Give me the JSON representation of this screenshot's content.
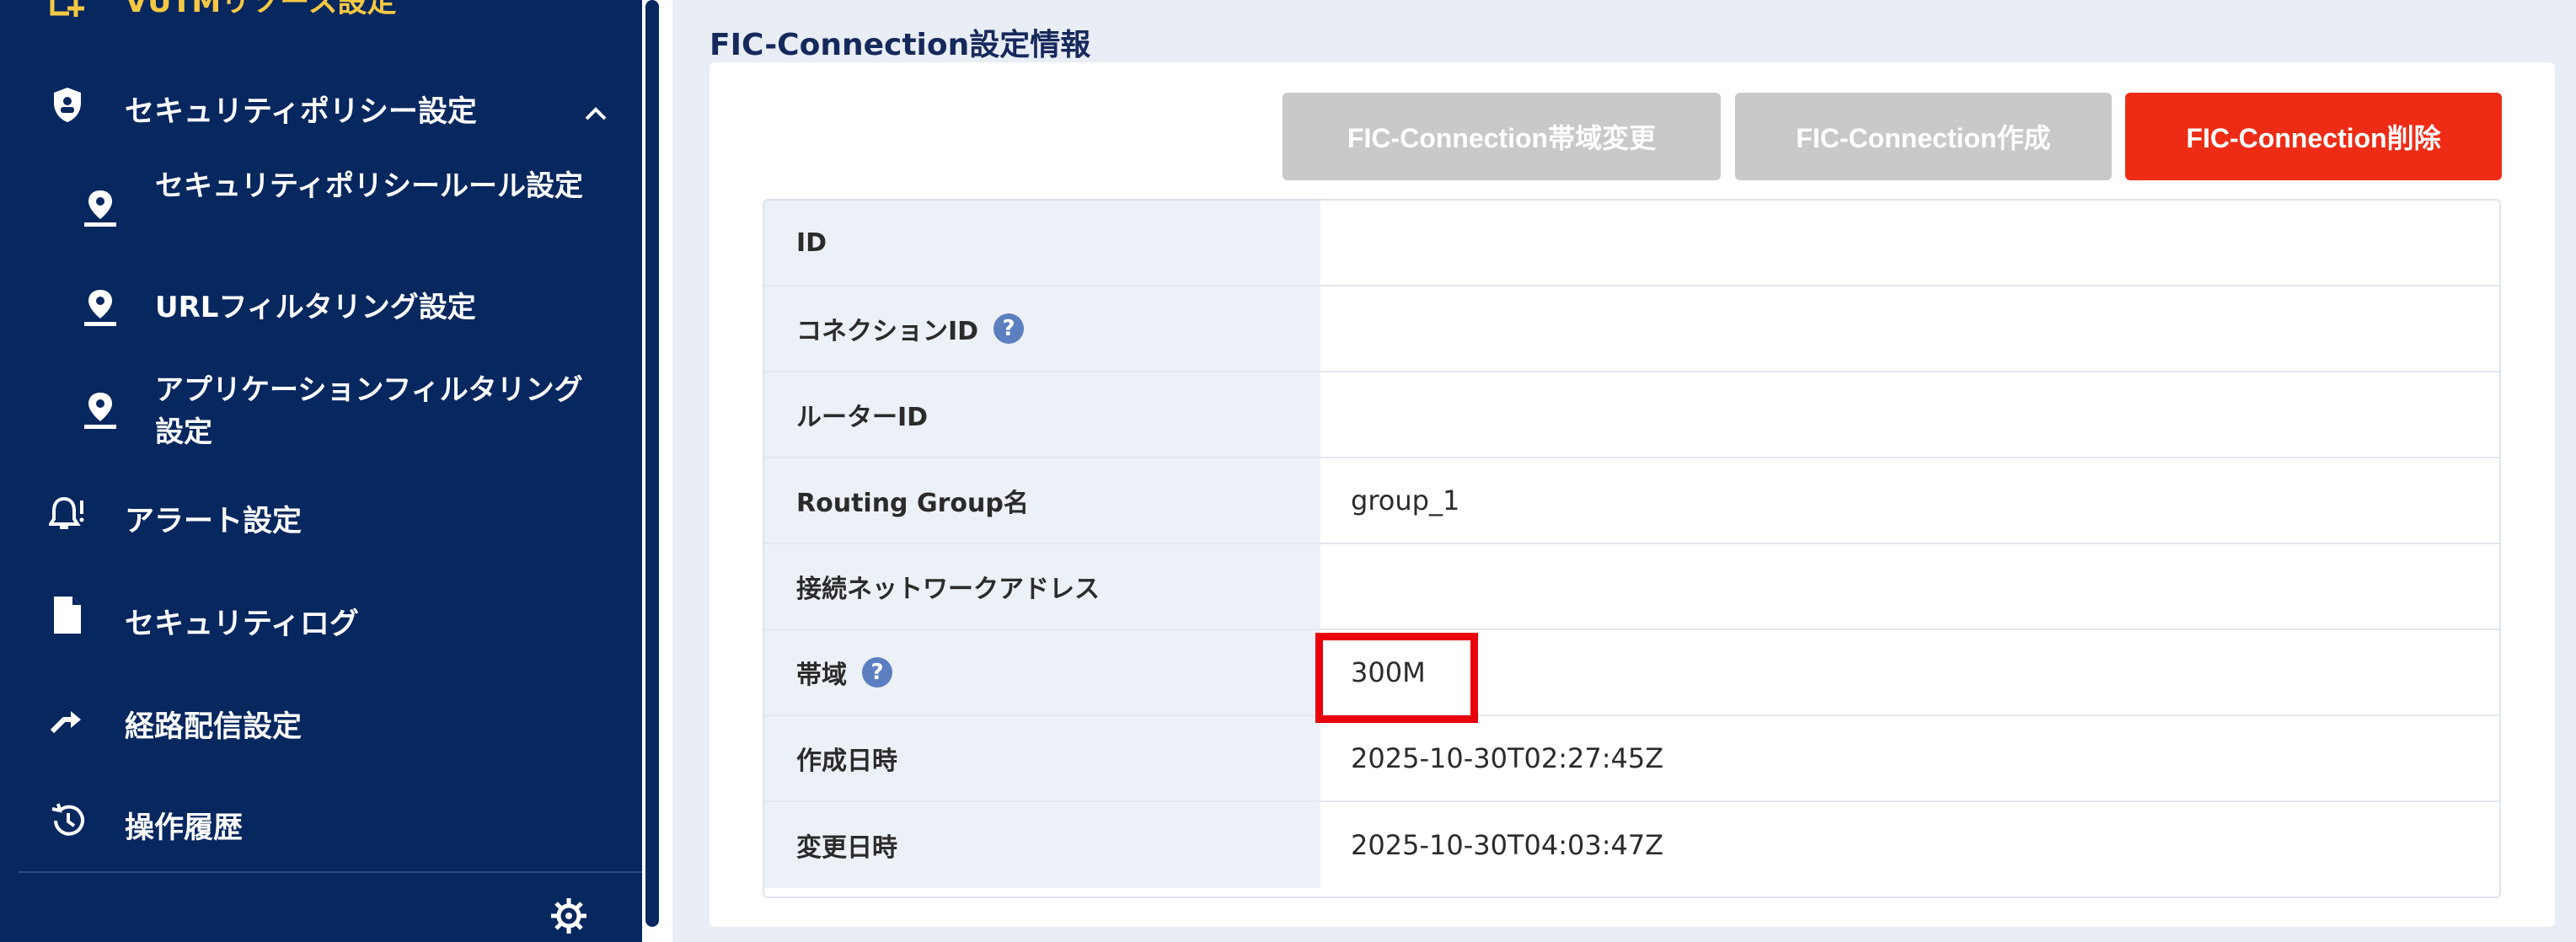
{
  "sidebar": {
    "top_item": "VUTMリソース設定",
    "security_policy": "セキュリティポリシー設定",
    "sub_items": [
      "セキュリティポリシールール設定",
      "URLフィルタリング設定",
      "アプリケーションフィルタリング設定"
    ],
    "items": [
      "アラート設定",
      "セキュリティログ",
      "経路配信設定",
      "操作履歴"
    ]
  },
  "main": {
    "section_title": "FIC-Connection設定情報",
    "buttons": {
      "change_bandwidth": "FIC-Connection帯域変更",
      "create": "FIC-Connection作成",
      "delete": "FIC-Connection削除"
    },
    "rows": [
      {
        "label": "ID",
        "value": ""
      },
      {
        "label": "コネクションID",
        "value": ""
      },
      {
        "label": "ルーターID",
        "value": ""
      },
      {
        "label": "Routing Group名",
        "value": "group_1"
      },
      {
        "label": "接続ネットワークアドレス",
        "value": ""
      },
      {
        "label": "帯域",
        "value": "300M"
      },
      {
        "label": "作成日時",
        "value": "2025-10-30T02:27:45Z"
      },
      {
        "label": "変更日時",
        "value": "2025-10-30T04:03:47Z"
      }
    ],
    "help_glyph": "?"
  },
  "colors": {
    "sidebar_bg": "#07275f",
    "danger": "#ee2c16",
    "disabled": "#c9c9c9",
    "highlight": "#e8000b"
  }
}
